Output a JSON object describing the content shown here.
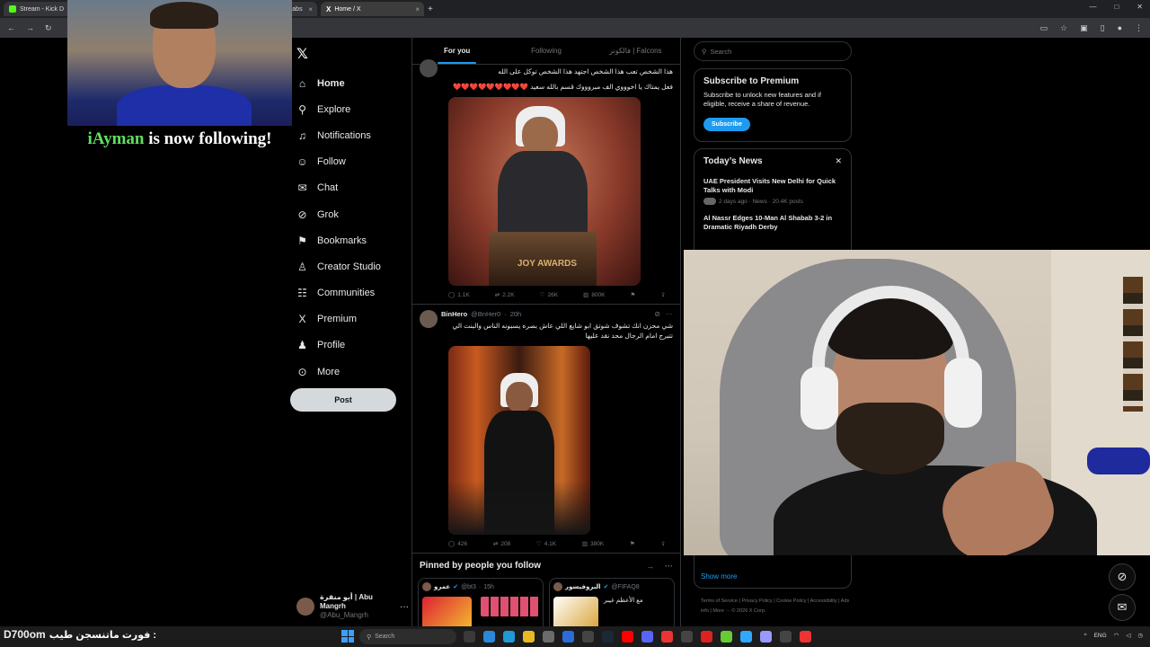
{
  "browser": {
    "tabs": [
      {
        "label": "Stream - Kick D",
        "color": "#53fc18",
        "active": false
      },
      {
        "label": "amlabs",
        "color": "#888888",
        "active": false
      },
      {
        "label": "Home / X",
        "color": "#ffffff",
        "active": true
      }
    ]
  },
  "overlay": {
    "follower": "iAyman",
    "follow_text": "is now following!"
  },
  "nav": {
    "items": [
      {
        "label": "Home",
        "icon": "home-icon",
        "glyph": "⌂",
        "active": true
      },
      {
        "label": "Explore",
        "icon": "search-icon",
        "glyph": "⚲"
      },
      {
        "label": "Notifications",
        "icon": "bell-icon",
        "glyph": "♫"
      },
      {
        "label": "Follow",
        "icon": "person-add-icon",
        "glyph": "☺"
      },
      {
        "label": "Chat",
        "icon": "mail-icon",
        "glyph": "✉"
      },
      {
        "label": "Grok",
        "icon": "grok-icon",
        "glyph": "⊘"
      },
      {
        "label": "Bookmarks",
        "icon": "bookmark-icon",
        "glyph": "⚑"
      },
      {
        "label": "Creator Studio",
        "icon": "creator-icon",
        "glyph": "♙"
      },
      {
        "label": "Communities",
        "icon": "communities-icon",
        "glyph": "☷"
      },
      {
        "label": "Premium",
        "icon": "x-icon",
        "glyph": "X"
      },
      {
        "label": "Profile",
        "icon": "profile-icon",
        "glyph": "♟"
      },
      {
        "label": "More",
        "icon": "more-icon",
        "glyph": "⊙"
      }
    ],
    "post_label": "Post"
  },
  "profile": {
    "display_name": "أبو منقرة | Abu Mangrh",
    "handle": "@Abu_Mangrh"
  },
  "timeline": {
    "tabs": [
      "For you",
      "Following",
      "فالكونز | Falcons"
    ],
    "tweet1": {
      "text1": "هذا الشخص تعب هذا الشخص اجتهد هذا الشخص توكل على الله",
      "text2": "فعل يمتاك يا اخوووي الف مبروووك قسم بالله سعيد",
      "hearts": "❤️❤️❤️❤️❤️❤️❤️❤️❤️",
      "stage_text": "JOY AWARDS",
      "replies": "1.1K",
      "reposts": "2.2K",
      "likes": "26K",
      "views": "800K"
    },
    "tweet2": {
      "name": "BinHero",
      "handle": "@BnHer0",
      "time": "20h",
      "text": "شي محزن انك تشوف شوتق ابو شايع  اللي عاش بصره يسبونه الناس والبنت الي تتبرج امام الرجال  محد نقد عليها",
      "replies": "426",
      "reposts": "208",
      "likes": "4.1K",
      "views": "380K"
    },
    "pinned": {
      "title": "Pinned by people you follow",
      "card1": {
        "name": "عمرو",
        "handle": "@bt3",
        "time": "15h"
      },
      "card2": {
        "name": "البروفيسور",
        "handle": "@FIFAQ8",
        "snippet": "مع الأعظم غيبر"
      }
    }
  },
  "right": {
    "search_placeholder": "Search",
    "premium": {
      "title": "Subscribe to Premium",
      "body": "Subscribe to unlock new features and if eligible, receive a share of revenue.",
      "button": "Subscribe"
    },
    "news": {
      "title": "Today’s News",
      "items": [
        {
          "headline": "UAE President Visits New Delhi for Quick Talks with Modi",
          "meta": "2 days ago · News · 20.4K posts"
        },
        {
          "headline": "Al Nassr Edges 10-Man Al Shabab 3-2 in Dramatic Riyadh Derby",
          "meta": ""
        }
      ],
      "show_more": "Show more"
    },
    "footer": "Terms of Service  |  Privacy Policy  |  Cookie Policy  |  Accessibility  |  Ads info  |  More ···  © 2026 X Corp."
  },
  "taskbar": {
    "chat_user": "D700om",
    "chat_message": "فورت ماتنسجن طيب :",
    "search_placeholder": "Search",
    "lang": "ENG",
    "app_colors": [
      "#3a3a3a",
      "#2b88d8",
      "#1e9bd7",
      "#e8b923",
      "#6b6b6b",
      "#2b6cd8",
      "#444444",
      "#1b2838",
      "#ff0000",
      "#5865f2",
      "#e33",
      "#444",
      "#d22",
      "#6c3",
      "#31a8ff",
      "#9999ff",
      "#444",
      "#e33"
    ]
  }
}
